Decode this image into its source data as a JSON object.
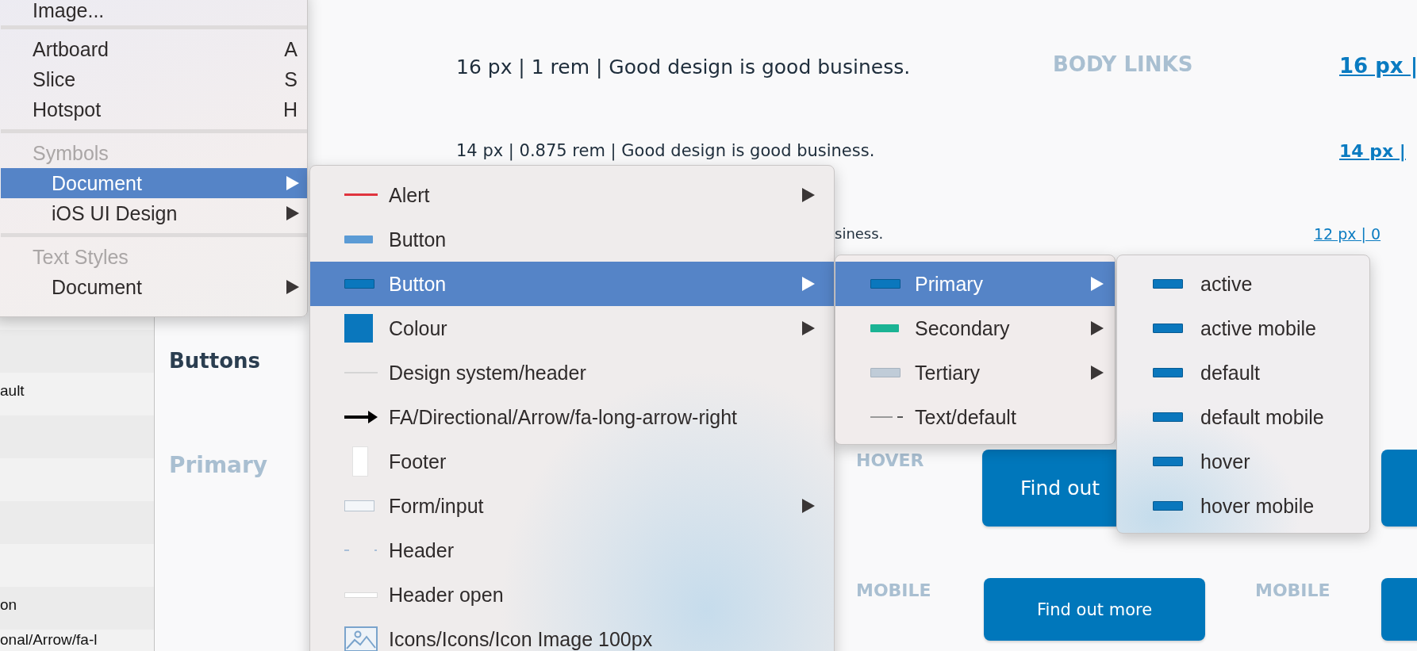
{
  "sidebar": {
    "rows": [
      {
        "label": "ault"
      },
      {
        "label": "on"
      },
      {
        "label": "onal/Arrow/fa-l"
      }
    ]
  },
  "canvas": {
    "section_title": "Buttons",
    "group_title": "Primary",
    "body_links_label": "BODY LINKS",
    "type_samples": [
      {
        "text": "16 px | 1 rem | Good design is good business.",
        "link": "16 px |"
      },
      {
        "text": "14 px | 0.875 rem | Good design is good business.",
        "link": "14 px |"
      },
      {
        "text": "siness.",
        "link": "12 px | 0"
      }
    ],
    "button_rows": [
      {
        "label": "HOVER",
        "button": "Find out"
      },
      {
        "label": "MOBILE",
        "button": "Find out more"
      }
    ],
    "second_column_label": "MOBILE"
  },
  "insert_menu": {
    "sections": [
      {
        "items": [
          {
            "label": "Image...",
            "selected": false,
            "has_submenu": false
          }
        ]
      },
      {
        "items": [
          {
            "label": "Artboard",
            "shortcut": "A",
            "selected": false,
            "has_submenu": false
          },
          {
            "label": "Slice",
            "shortcut": "S",
            "selected": false,
            "has_submenu": false
          },
          {
            "label": "Hotspot",
            "shortcut": "H",
            "selected": false,
            "has_submenu": false
          }
        ]
      },
      {
        "header": "Symbols",
        "items": [
          {
            "label": "Document",
            "selected": true,
            "has_submenu": true
          },
          {
            "label": "iOS UI Design",
            "selected": false,
            "has_submenu": true
          }
        ]
      },
      {
        "header": "Text Styles",
        "items": [
          {
            "label": "Document",
            "selected": false,
            "has_submenu": true
          }
        ]
      }
    ]
  },
  "symbols_menu": {
    "items": [
      {
        "label": "Alert",
        "selected": false,
        "has_submenu": true
      },
      {
        "label": "Button",
        "selected": false,
        "has_submenu": false
      },
      {
        "label": "Button",
        "selected": true,
        "has_submenu": true
      },
      {
        "label": "Colour",
        "selected": false,
        "has_submenu": true
      },
      {
        "label": "Design system/header",
        "selected": false,
        "has_submenu": false
      },
      {
        "label": "FA/Directional/Arrow/fa-long-arrow-right",
        "selected": false,
        "has_submenu": false
      },
      {
        "label": "Footer",
        "selected": false,
        "has_submenu": false
      },
      {
        "label": "Form/input",
        "selected": false,
        "has_submenu": true
      },
      {
        "label": "Header",
        "selected": false,
        "has_submenu": false
      },
      {
        "label": "Header open",
        "selected": false,
        "has_submenu": false
      },
      {
        "label": "Icons/Icons/Icon Image 100px",
        "selected": false,
        "has_submenu": false
      }
    ]
  },
  "button_menu": {
    "items": [
      {
        "label": "Primary",
        "selected": true,
        "has_submenu": true
      },
      {
        "label": "Secondary",
        "selected": false,
        "has_submenu": true
      },
      {
        "label": "Tertiary",
        "selected": false,
        "has_submenu": true
      },
      {
        "label": "Text/default",
        "selected": false,
        "has_submenu": false
      }
    ]
  },
  "primary_menu": {
    "items": [
      {
        "label": "active",
        "selected": false,
        "has_submenu": false
      },
      {
        "label": "active mobile",
        "selected": false,
        "has_submenu": false
      },
      {
        "label": "default",
        "selected": false,
        "has_submenu": false
      },
      {
        "label": "default mobile",
        "selected": false,
        "has_submenu": false
      },
      {
        "label": "hover",
        "selected": false,
        "has_submenu": false
      },
      {
        "label": "hover mobile",
        "selected": false,
        "has_submenu": false
      }
    ]
  }
}
